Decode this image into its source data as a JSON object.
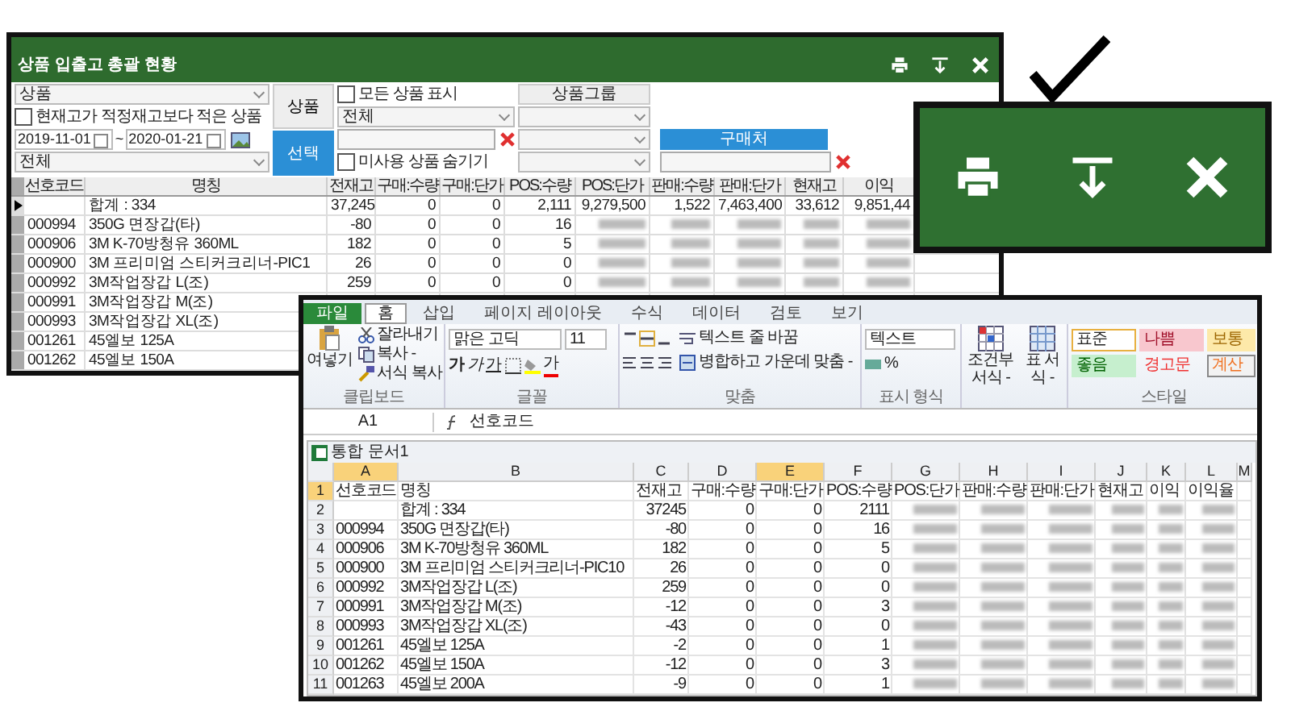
{
  "app": {
    "title": "상품 입출고 총괄 현황",
    "filters": {
      "item_type": "상품",
      "low_stock": {
        "label": "현재고가 적정재고보다 적은 상품",
        "checked": false
      },
      "date_from": "2019-11-01",
      "date_separator": "~",
      "date_to": "2020-01-21",
      "category": "전체",
      "product_button": "상품",
      "select_button": "선택",
      "show_all": {
        "label": "모든 상품 표시",
        "checked": false
      },
      "product_dropdown": "전체",
      "hide_unused": {
        "label": "미사용 상품 숨기기",
        "checked": false
      },
      "group_header": "상품그룹",
      "vendor_button": "구매처"
    },
    "table": {
      "columns": [
        "선호코드",
        "명칭",
        "전재고",
        "구매:수량",
        "구매:단가",
        "POS:수량",
        "POS:단가",
        "판매:수량",
        "판매:단가",
        "현재고",
        "이익"
      ],
      "rows": [
        {
          "selected": true,
          "name": "합계 : 334",
          "values": [
            "37,245",
            "0",
            "0",
            "2,111",
            "9,279,500",
            "1,522",
            "7,463,400",
            "33,612",
            "9,851,44"
          ]
        },
        {
          "selected": false,
          "blurred": true,
          "code": "000994",
          "name": "350G 면장갑(타)",
          "values": [
            "-80",
            "0",
            "0",
            "16"
          ]
        },
        {
          "selected": false,
          "blurred": true,
          "code": "000906",
          "name": "3M K-70방청유 360ML",
          "values": [
            "182",
            "0",
            "0",
            "5"
          ]
        },
        {
          "selected": false,
          "blurred": true,
          "code": "000900",
          "name": "3M 프리미엄 스티커크리너-PIC1",
          "values": [
            "26",
            "0",
            "0",
            "0"
          ]
        },
        {
          "selected": false,
          "blurred": true,
          "code": "000992",
          "name": "3M작업장갑 L(조)",
          "values": [
            "259",
            "0",
            "0",
            "0"
          ]
        },
        {
          "selected": false,
          "code": "000991",
          "name": "3M작업장갑 M(조)"
        },
        {
          "selected": false,
          "code": "000993",
          "name": "3M작업장갑 XL(조)"
        },
        {
          "selected": false,
          "code": "001261",
          "name": "45엘보 125A"
        },
        {
          "selected": false,
          "code": "001262",
          "name": "45엘보 150A"
        }
      ]
    }
  },
  "excel": {
    "tabs": [
      {
        "label": "파일",
        "kind": "file",
        "selected": false
      },
      {
        "label": "홈",
        "kind": "tab",
        "selected": true
      },
      {
        "label": "삽입",
        "kind": "tab",
        "selected": false
      },
      {
        "label": "페이지 레이아웃",
        "kind": "tab",
        "selected": false
      },
      {
        "label": "수식",
        "kind": "tab",
        "selected": false
      },
      {
        "label": "데이터",
        "kind": "tab",
        "selected": false
      },
      {
        "label": "검토",
        "kind": "tab",
        "selected": false
      },
      {
        "label": "보기",
        "kind": "tab",
        "selected": false
      }
    ],
    "clipboard": {
      "paste": "여넣기",
      "cut": "잘라내기",
      "copy": "복사 -",
      "format_painter": "서식 복사",
      "label": "클립보드"
    },
    "font": {
      "name": "맑은 고딕",
      "size": "11",
      "bold": "가",
      "italic": "가",
      "underline": "가",
      "font_color_button": "가",
      "label": "글꼴"
    },
    "alignment": {
      "wrap": "텍스트 줄 바꿈",
      "merge": "병합하고 가운데 맞춤 -",
      "label": "맞춤"
    },
    "number": {
      "format": "텍스트",
      "percent": "%",
      "label": "표시 형식"
    },
    "conditional": "조건부 서식 -",
    "table_format": "표 서식 -",
    "styles": {
      "label": "스타일",
      "items": [
        {
          "label": "표준",
          "kind": "normal"
        },
        {
          "label": "나쁨",
          "kind": "bad"
        },
        {
          "label": "보통",
          "kind": "neutral"
        },
        {
          "label": "좋음",
          "kind": "good"
        },
        {
          "label": "경고문",
          "kind": "warning"
        },
        {
          "label": "계산",
          "kind": "calc"
        }
      ]
    },
    "name_box": "A1",
    "formula": "선호코드",
    "workbook": "통합 문서1",
    "columns": [
      {
        "label": "A",
        "selected": true
      },
      {
        "label": "B",
        "selected": false
      },
      {
        "label": "C",
        "selected": false
      },
      {
        "label": "D",
        "selected": false
      },
      {
        "label": "E",
        "selected": true
      },
      {
        "label": "F",
        "selected": false
      },
      {
        "label": "G",
        "selected": false
      },
      {
        "label": "H",
        "selected": false
      },
      {
        "label": "I",
        "selected": false
      },
      {
        "label": "J",
        "selected": false
      },
      {
        "label": "K",
        "selected": false
      },
      {
        "label": "L",
        "selected": false
      },
      {
        "label": "M",
        "selected": false
      }
    ],
    "rows": [
      {
        "number": "1",
        "selected": true,
        "code": "선호코드",
        "name": "명칭",
        "values": [
          "전재고",
          "구매:수량",
          "구매:단가",
          "POS:수량",
          "POS:단가",
          "판매:수량",
          "판매:단가",
          "현재고",
          "이익",
          "이익율"
        ]
      },
      {
        "number": "2",
        "selected": false,
        "blurred": true,
        "name": "합계 : 334",
        "values": [
          "37245",
          "0",
          "0",
          "2111"
        ]
      },
      {
        "number": "3",
        "selected": false,
        "blurred": true,
        "code": "000994",
        "name": "350G 면장갑(타)",
        "values": [
          "-80",
          "0",
          "0",
          "16"
        ]
      },
      {
        "number": "4",
        "selected": false,
        "blurred": true,
        "code": "000906",
        "name": "3M K-70방청유 360ML",
        "values": [
          "182",
          "0",
          "0",
          "5"
        ]
      },
      {
        "number": "5",
        "selected": false,
        "blurred": true,
        "code": "000900",
        "name": "3M 프리미엄 스티커크리너-PIC10",
        "values": [
          "26",
          "0",
          "0",
          "0"
        ]
      },
      {
        "number": "6",
        "selected": false,
        "blurred": true,
        "code": "000992",
        "name": "3M작업장갑 L(조)",
        "values": [
          "259",
          "0",
          "0",
          "0"
        ]
      },
      {
        "number": "7",
        "selected": false,
        "blurred": true,
        "code": "000991",
        "name": "3M작업장갑 M(조)",
        "values": [
          "-12",
          "0",
          "0",
          "3"
        ]
      },
      {
        "number": "8",
        "selected": false,
        "blurred": true,
        "code": "000993",
        "name": "3M작업장갑 XL(조)",
        "values": [
          "-43",
          "0",
          "0",
          "0"
        ]
      },
      {
        "number": "9",
        "selected": false,
        "blurred": true,
        "code": "001261",
        "name": "45엘보 125A",
        "values": [
          "-2",
          "0",
          "0",
          "1"
        ]
      },
      {
        "number": "10",
        "selected": false,
        "blurred": true,
        "code": "001262",
        "name": "45엘보 150A",
        "values": [
          "-12",
          "0",
          "0",
          "3"
        ]
      },
      {
        "number": "11",
        "selected": false,
        "blurred": true,
        "code": "001263",
        "name": "45엘보 200A",
        "values": [
          "-9",
          "0",
          "0",
          "1"
        ]
      }
    ]
  }
}
